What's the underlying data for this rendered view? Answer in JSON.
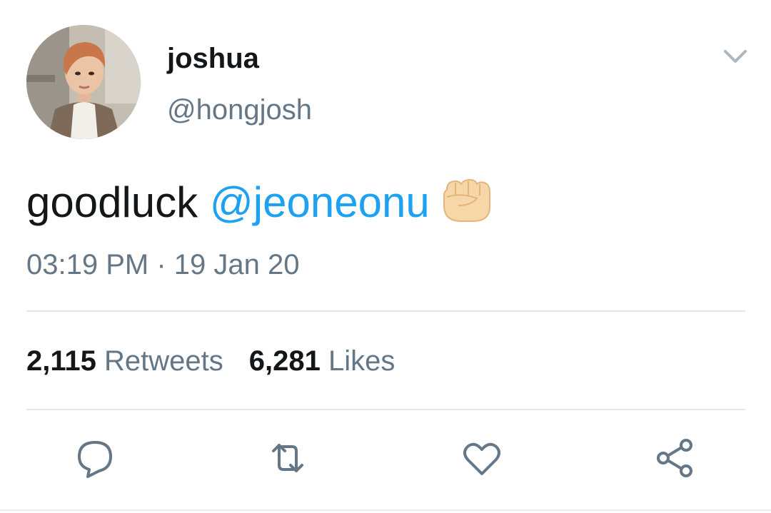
{
  "tweet": {
    "display_name": "joshua",
    "handle": "@hongjosh",
    "text": "goodluck ",
    "mention": "@jeoneonu",
    "emoji": "raised-fist-icon",
    "timestamp": "03:19 PM · 19 Jan 20"
  },
  "stats": {
    "retweets_count": "2,115",
    "retweets_label": "Retweets",
    "likes_count": "6,281",
    "likes_label": "Likes"
  },
  "actions": [
    "reply-icon",
    "retweet-icon",
    "like-icon",
    "share-icon"
  ],
  "colors": {
    "text": "#14171a",
    "secondary": "#657786",
    "link": "#1da1f2",
    "divider": "#e1e8ed"
  }
}
